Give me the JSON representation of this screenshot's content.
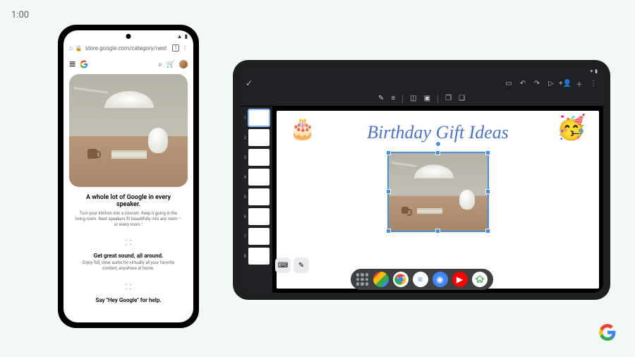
{
  "clock": "1:00",
  "phone": {
    "url": "store.google.com/category/nest",
    "tab_count": "1",
    "heading": "A whole lot of Google in every speaker.",
    "para1": "Turn your kitchen into a concert. Keep it going in the living room. Nest speakers fit beautifully into any room – or every room.¹",
    "sub1": "Get great sound, all around.",
    "para2": "Enjoy full, clear audio for virtually all your favorite content, anywhere at home.",
    "sub2": "Say \"Hey Google\" for help."
  },
  "tablet": {
    "slide_title": "Birthday Gift Ideas",
    "emoji_cake": "🎂",
    "emoji_party": "🥳",
    "thumbs": [
      1,
      2,
      3,
      4,
      5,
      6,
      7,
      8
    ],
    "active_thumb": 1,
    "taskbar_apps": [
      "gmail",
      "chrome",
      "docs",
      "camera",
      "youtube",
      "home"
    ]
  }
}
